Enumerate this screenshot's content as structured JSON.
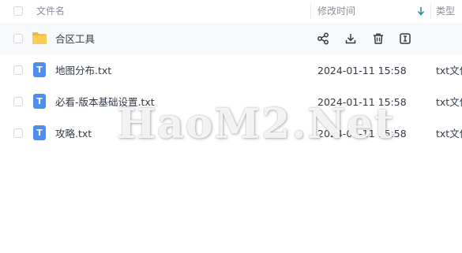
{
  "header": {
    "name_label": "文件名",
    "modified_label": "修改时间",
    "type_label": "类型"
  },
  "rows": [
    {
      "name": "合区工具",
      "kind": "folder",
      "date": "",
      "type": "",
      "actions": [
        "share-icon",
        "download-icon",
        "delete-icon",
        "rename-icon"
      ]
    },
    {
      "name": "地图分布.txt",
      "kind": "txt",
      "icon_letter": "T",
      "date": "2024-01-11 15:58",
      "type": "txt文件"
    },
    {
      "name": "必看-版本基础设置.txt",
      "kind": "txt",
      "icon_letter": "T",
      "date": "2024-01-11 15:58",
      "type": "txt文件"
    },
    {
      "name": "攻略.txt",
      "kind": "txt",
      "icon_letter": "T",
      "date": "2024-01-11 15:58",
      "type": "txt文件"
    }
  ],
  "watermark": "HaoM2.Net",
  "colors": {
    "folder": "#f6c443",
    "doc_icon": "#4b8ff0",
    "sort_arrow": "#2c8c99",
    "hover_row": "#f7f8fa"
  }
}
